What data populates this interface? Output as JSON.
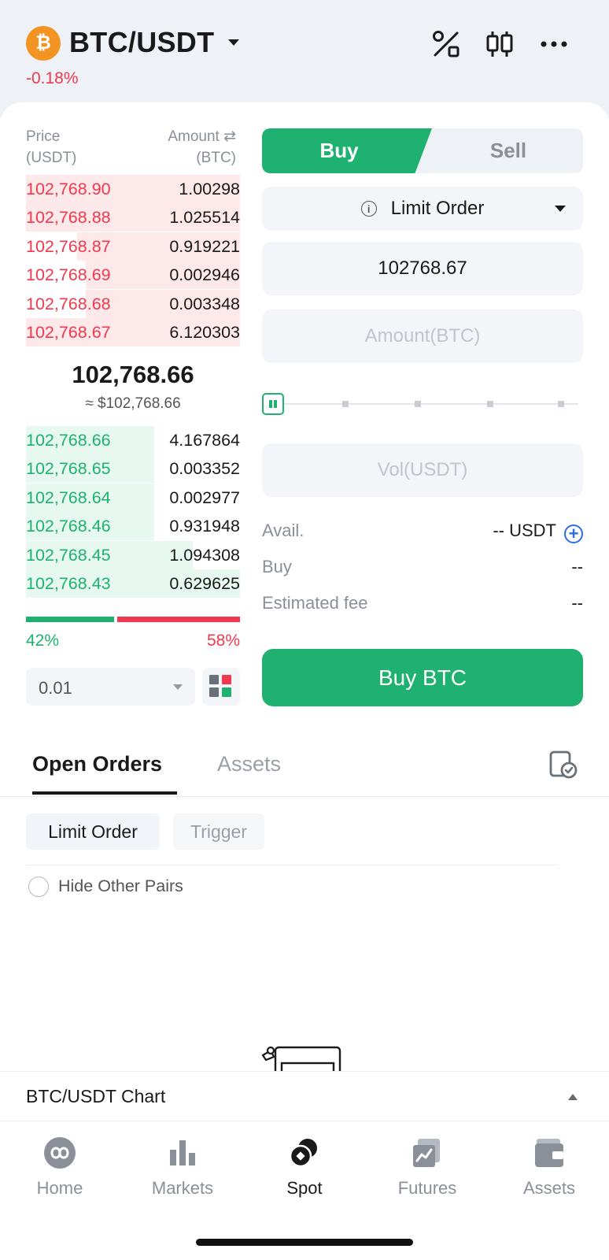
{
  "header": {
    "coin_symbol": "₿",
    "pair": "BTC/USDT",
    "change": "-0.18%",
    "icons": [
      "percent-swap-icon",
      "candlestick-icon",
      "more-icon"
    ]
  },
  "orderbook": {
    "price_header": [
      "Price",
      "(USDT)"
    ],
    "amount_header": [
      "Amount ⇄",
      "(BTC)"
    ],
    "asks": [
      {
        "price": "102,768.90",
        "amount": "1.00298",
        "depth": 1.0
      },
      {
        "price": "102,768.88",
        "amount": "1.025514",
        "depth": 1.0
      },
      {
        "price": "102,768.87",
        "amount": "0.919221",
        "depth": 0.76
      },
      {
        "price": "102,768.69",
        "amount": "0.002946",
        "depth": 0.72
      },
      {
        "price": "102,768.68",
        "amount": "0.003348",
        "depth": 0.72
      },
      {
        "price": "102,768.67",
        "amount": "6.120303",
        "depth": 1.0
      }
    ],
    "last_price": "102,768.66",
    "last_price_usd": "≈ $102,768.66",
    "bids": [
      {
        "price": "102,768.66",
        "amount": "4.167864",
        "depth": 0.6
      },
      {
        "price": "102,768.65",
        "amount": "0.003352",
        "depth": 0.6
      },
      {
        "price": "102,768.64",
        "amount": "0.002977",
        "depth": 0.6
      },
      {
        "price": "102,768.46",
        "amount": "0.931948",
        "depth": 0.6
      },
      {
        "price": "102,768.45",
        "amount": "1.094308",
        "depth": 0.78
      },
      {
        "price": "102,768.43",
        "amount": "0.629625",
        "depth": 1.0
      }
    ],
    "buy_ratio": 42,
    "buy_ratio_label": "42%",
    "sell_ratio_label": "58%",
    "precision": "0.01"
  },
  "trade": {
    "buy_tab": "Buy",
    "sell_tab": "Sell",
    "order_type": "Limit Order",
    "price_value": "102768.67",
    "amount_placeholder": "Amount(BTC)",
    "vol_placeholder": "Vol(USDT)",
    "slider_percent": 0,
    "avail_label": "Avail.",
    "avail_value": "-- USDT",
    "buy_label": "Buy",
    "buy_value": "--",
    "fee_label": "Estimated fee",
    "fee_value": "--",
    "submit_label": "Buy BTC"
  },
  "orders": {
    "tabs": [
      "Open Orders",
      "Assets"
    ],
    "filters": [
      "Limit Order",
      "Trigger"
    ],
    "hide_other_pairs": "Hide Other Pairs"
  },
  "chart_bar": {
    "label": "BTC/USDT Chart"
  },
  "nav": [
    {
      "label": "Home",
      "icon": "home-icon"
    },
    {
      "label": "Markets",
      "icon": "markets-icon"
    },
    {
      "label": "Spot",
      "icon": "spot-icon",
      "active": true
    },
    {
      "label": "Futures",
      "icon": "futures-icon"
    },
    {
      "label": "Assets",
      "icon": "wallet-icon"
    }
  ],
  "colors": {
    "buy": "#1fb170",
    "sell": "#f0384f",
    "coin": "#f39322",
    "link": "#2b6fde"
  }
}
